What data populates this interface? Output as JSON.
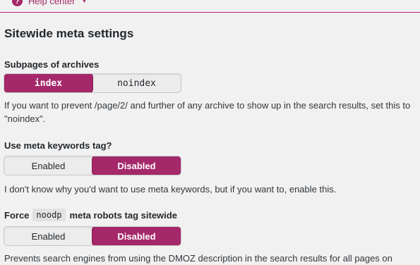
{
  "header": {
    "help_label": "Help center",
    "help_icon": "question-circle-icon",
    "caret_icon": "chevron-down-icon",
    "accent_color": "#a4286a"
  },
  "section": {
    "title": "Sitewide meta settings"
  },
  "settings": [
    {
      "label": "Subpages of archives",
      "options": [
        "index",
        "noindex"
      ],
      "selected": "index",
      "help": "If you want to prevent /page/2/ and further of any archive to show up in the search results, set this to \"noindex\"."
    },
    {
      "label": "Use meta keywords tag?",
      "options": [
        "Enabled",
        "Disabled"
      ],
      "selected": "Disabled",
      "help": "I don't know why you'd want to use meta keywords, but if you want to, enable this."
    },
    {
      "label_prefix": "Force",
      "label_code": "noodp",
      "label_suffix": "meta robots tag sitewide",
      "options": [
        "Enabled",
        "Disabled"
      ],
      "selected": "Disabled",
      "help": "Prevents search engines from using the DMOZ description in the search results for all pages on"
    }
  ]
}
